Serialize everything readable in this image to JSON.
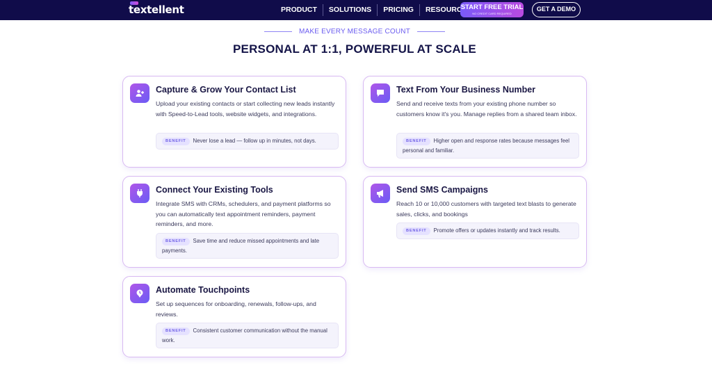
{
  "nav": {
    "logo": "textellent",
    "links": [
      "PRODUCT",
      "SOLUTIONS",
      "PRICING",
      "RESOURCES"
    ],
    "trial_label": "START FREE TRIAL",
    "trial_sub": "NO CREDIT CARD REQUIRED",
    "demo_label": "GET A DEMO"
  },
  "section": {
    "eyebrow": "MAKE EVERY MESSAGE COUNT",
    "headline": "PERSONAL AT 1:1, POWERFUL AT SCALE"
  },
  "cards": [
    {
      "icon": "add-contact-icon",
      "title": "Capture & Grow Your Contact List",
      "description": "Upload your existing contacts or start collecting new leads instantly with Speed-to-Lead tools, website widgets, and integrations.",
      "benefit_label": "BENEFIT",
      "benefit": "Never lose a lead — follow up in minutes, not days."
    },
    {
      "icon": "chat-bubble-icon",
      "title": "Text From Your Business Number",
      "description": "Send and receive texts from your existing phone number so customers know it's you. Manage replies from a shared team inbox.",
      "benefit_label": "BENEFIT",
      "benefit": "Higher open and response rates because messages feel personal and familiar."
    },
    {
      "icon": "plug-icon",
      "title": "Connect Your Existing Tools",
      "description": "Integrate SMS with CRMs, schedulers, and payment platforms so you can automatically text appointment reminders, payment reminders, and more.",
      "benefit_label": "BENEFIT",
      "benefit": "Save time and reduce missed appointments and late payments."
    },
    {
      "icon": "megaphone-icon",
      "title": "Send SMS Campaigns",
      "description": "Reach 10 or 10,000 customers with targeted text blasts to generate sales, clicks, and bookings",
      "benefit_label": "BENEFIT",
      "benefit": "Promote offers or updates instantly and track results."
    },
    {
      "icon": "clock-pin-icon",
      "title": "Automate Touchpoints",
      "description": "Set up sequences for onboarding, renewals, follow-ups, and reviews.",
      "benefit_label": "BENEFIT",
      "benefit": "Consistent customer communication without the manual work."
    }
  ]
}
